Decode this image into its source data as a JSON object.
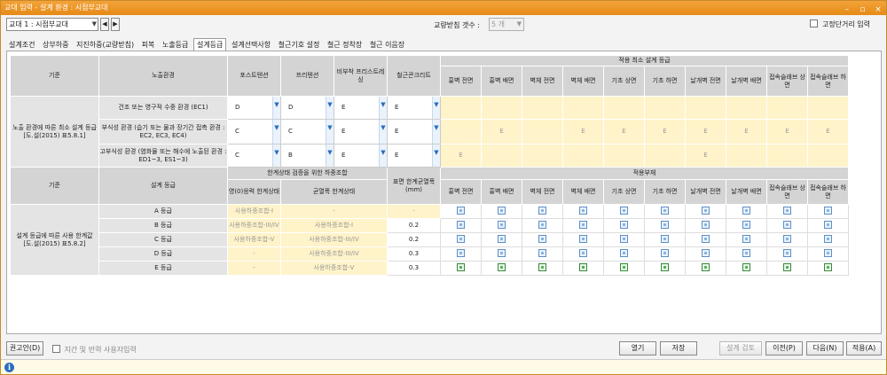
{
  "window": {
    "title": "교대 입력 - 설계 환경 : 시점부교대",
    "min": "–",
    "max": "▫",
    "close": "×"
  },
  "topbar": {
    "pier_value": "교대 1 : 시점부교대",
    "bearing_label": "교량받침 갯수 :",
    "bearing_value": "5 개",
    "fixed_distance_label": "고정단거리 입력"
  },
  "tabs": [
    "설계조건",
    "상부하중",
    "지진하중(교량받침)",
    "피복",
    "노출등급",
    "설계등급",
    "설계선택사항",
    "철근기호 설정",
    "철근 정착장",
    "철근 이음장"
  ],
  "exposure": {
    "col_header_criteria": "기준",
    "col_header_env": "노출환경",
    "col_post": "포스트텐션",
    "col_pre": "프리텐션",
    "col_nonpre": "비부착 프리스트레싱",
    "col_rc": "철근콘크리트",
    "group_header": "적용 최소 설계 등급",
    "parts": [
      "흉벽 전면",
      "흉벽 배면",
      "벽체 전면",
      "벽체 배면",
      "기초 상면",
      "기초 하면",
      "날개벽 전면",
      "날개벽 배면",
      "접속슬래브 상면",
      "접속슬래브 하면"
    ],
    "criteria_text": "노출 환경에 따른 최소 설계 등급 [도.설(2015) 표5.8.1]",
    "rows": [
      {
        "env": "건조 또는 영구적 수중 환경 (EC1)",
        "post": "D",
        "pre": "D",
        "nonpre": "E",
        "rc": "E",
        "marks": [
          "",
          "",
          "",
          "",
          "",
          "",
          "",
          "",
          "",
          ""
        ]
      },
      {
        "env": "부식성 환경 (습기 또는 물과 장기간 접촉 환경 : EC2, EC3, EC4)",
        "post": "C",
        "pre": "C",
        "nonpre": "E",
        "rc": "E",
        "marks": [
          "",
          "E",
          "",
          "E",
          "E",
          "E",
          "E",
          "E",
          "E",
          "E"
        ]
      },
      {
        "env": "고부식성 환경 (염화물 또는 해수에 노출된 환경 : ED1~3, ES1~3)",
        "post": "C",
        "pre": "B",
        "nonpre": "E",
        "rc": "E",
        "marks": [
          "E",
          "",
          "",
          "",
          "",
          "",
          "E",
          "",
          "",
          ""
        ]
      }
    ]
  },
  "design": {
    "col_header_criteria": "기준",
    "col_header_grade": "설계 등급",
    "limit_header": "한계상태 검증을 위한 하중조합",
    "col_zero": "영(0)응력 한계상태",
    "col_crack": "균열폭 한계상태",
    "col_width": "표면 한계균열폭 (mm)",
    "members_header": "적용부재",
    "criteria_text": "설계 등급에 따른 사용 한계값 [도.설(2015) 표5.8.2]",
    "rows": [
      {
        "grade": "A 등급",
        "zero": "사용하중조합-I",
        "crack": "-",
        "width": "-",
        "on": [
          false,
          false,
          false,
          false,
          false,
          false,
          false,
          false,
          false,
          false
        ]
      },
      {
        "grade": "B 등급",
        "zero": "사용하중조합-III/IV",
        "crack": "사용하중조합-I",
        "width": "0.2",
        "on": [
          false,
          false,
          false,
          false,
          false,
          false,
          false,
          false,
          false,
          false
        ]
      },
      {
        "grade": "C 등급",
        "zero": "사용하중조합-V",
        "crack": "사용하중조합-III/IV",
        "width": "0.2",
        "on": [
          false,
          false,
          false,
          false,
          false,
          false,
          false,
          false,
          false,
          false
        ]
      },
      {
        "grade": "D 등급",
        "zero": "-",
        "crack": "사용하중조합-III/IV",
        "width": "0.3",
        "on": [
          false,
          false,
          false,
          false,
          false,
          false,
          false,
          false,
          false,
          false
        ]
      },
      {
        "grade": "E 등급",
        "zero": "-",
        "crack": "사용하중조합-V",
        "width": "0.3",
        "on": [
          true,
          true,
          true,
          true,
          true,
          true,
          true,
          true,
          true,
          true
        ]
      }
    ]
  },
  "bottombar": {
    "recommend": "권고안(D)",
    "ignore": "지간 및 반력 사용자입력",
    "open": "열기",
    "save": "저장",
    "check": "설계 검토",
    "prev": "이전(P)",
    "next": "다음(N)",
    "apply": "적용(A)"
  },
  "status": {
    "icon": "i"
  }
}
